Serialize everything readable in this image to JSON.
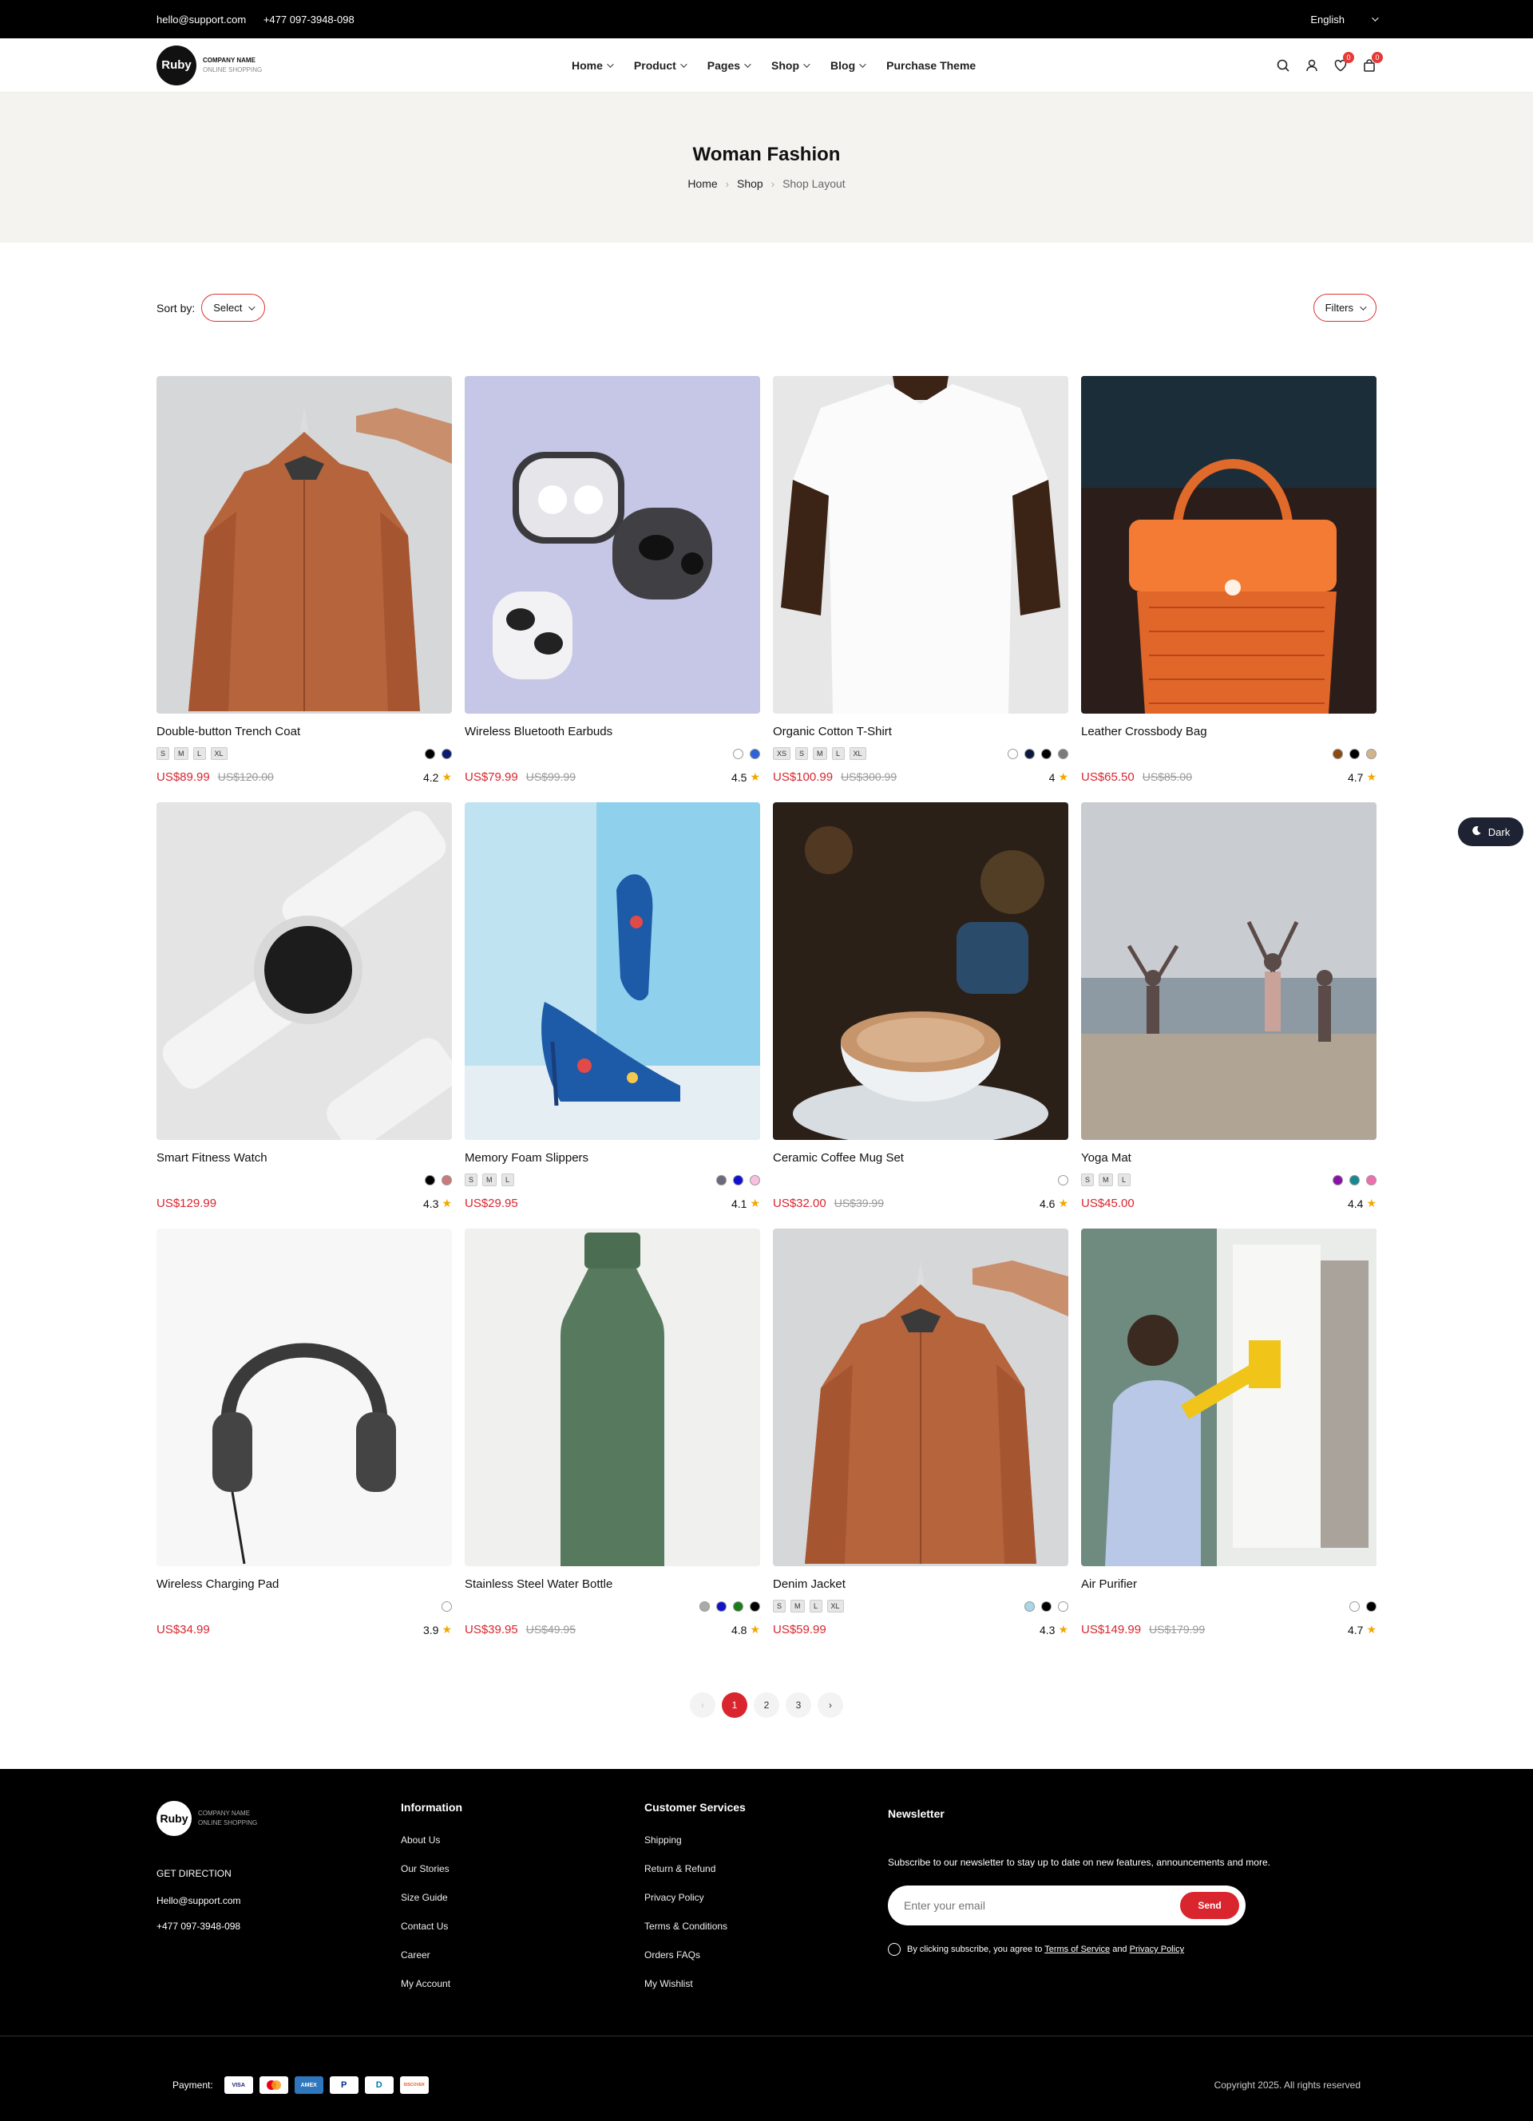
{
  "topbar": {
    "email": "hello@support.com",
    "phone": "+477 097-3948-098",
    "language": "English"
  },
  "header": {
    "logo_text": "Ruby",
    "company": "COMPANY NAME",
    "tagline": "ONLINE SHOPPING",
    "nav": [
      "Home",
      "Product",
      "Pages",
      "Shop",
      "Blog",
      "Purchase Theme"
    ],
    "wishlist_count": "0",
    "cart_count": "0"
  },
  "hero": {
    "title": "Woman Fashion",
    "crumbs": [
      "Home",
      "Shop",
      "Shop Layout"
    ]
  },
  "toolbar": {
    "sort_label": "Sort by:",
    "sort_value": "Select",
    "filters": "Filters"
  },
  "products": [
    {
      "name": "Double-button Trench Coat",
      "sizes": [
        "S",
        "M",
        "L",
        "XL"
      ],
      "colors": [
        "#000000",
        "#0a1a6e"
      ],
      "price": "US$89.99",
      "old": "US$120.00",
      "rating": "4.2",
      "image": "trench-jacket"
    },
    {
      "name": "Wireless Bluetooth Earbuds",
      "sizes": [],
      "colors": [
        "#ffffff",
        "#2e62d6"
      ],
      "price": "US$79.99",
      "old": "US$99.99",
      "rating": "4.5",
      "image": "earbuds"
    },
    {
      "name": "Organic Cotton T-Shirt",
      "sizes": [
        "XS",
        "S",
        "M",
        "L",
        "XL"
      ],
      "colors": [
        "#ffffff",
        "#0a1a3e",
        "#000000",
        "#7a7a7a"
      ],
      "price": "US$100.99",
      "old": "US$300.99",
      "rating": "4",
      "image": "tshirt"
    },
    {
      "name": "Leather Crossbody Bag",
      "sizes": [],
      "colors": [
        "#8b4a12",
        "#000000",
        "#d2b48c"
      ],
      "price": "US$65.50",
      "old": "US$85.00",
      "rating": "4.7",
      "image": "bag"
    },
    {
      "name": "Smart Fitness Watch",
      "sizes": [],
      "colors": [
        "#000000",
        "#c97b7b"
      ],
      "price": "US$129.99",
      "old": "",
      "rating": "4.3",
      "image": "watch"
    },
    {
      "name": "Memory Foam Slippers",
      "sizes": [
        "S",
        "M",
        "L"
      ],
      "colors": [
        "#6a6a7a",
        "#1010d0",
        "#f6c2e0"
      ],
      "price": "US$29.95",
      "old": "",
      "rating": "4.1",
      "image": "heels"
    },
    {
      "name": "Ceramic Coffee Mug Set",
      "sizes": [],
      "colors": [
        "#ffffff"
      ],
      "price": "US$32.00",
      "old": "US$39.99",
      "rating": "4.6",
      "image": "coffee"
    },
    {
      "name": "Yoga Mat",
      "sizes": [
        "S",
        "M",
        "L"
      ],
      "colors": [
        "#8a12a6",
        "#188890",
        "#ef6fae"
      ],
      "price": "US$45.00",
      "old": "",
      "rating": "4.4",
      "image": "yoga"
    },
    {
      "name": "Wireless Charging Pad",
      "sizes": [],
      "colors": [
        "#ffffff"
      ],
      "price": "US$34.99",
      "old": "",
      "rating": "3.9",
      "image": "headphones"
    },
    {
      "name": "Stainless Steel Water Bottle",
      "sizes": [],
      "colors": [
        "#aaaaaa",
        "#1212c8",
        "#1b7d1b",
        "#000000"
      ],
      "price": "US$39.95",
      "old": "US$49.95",
      "rating": "4.8",
      "image": "bottle"
    },
    {
      "name": "Denim Jacket",
      "sizes": [
        "S",
        "M",
        "L",
        "XL"
      ],
      "colors": [
        "#a7d6e8",
        "#000000",
        "#ffffff"
      ],
      "price": "US$59.99",
      "old": "",
      "rating": "4.3",
      "image": "trench-jacket"
    },
    {
      "name": "Air Purifier",
      "sizes": [],
      "colors": [
        "#ffffff",
        "#000000"
      ],
      "price": "US$149.99",
      "old": "US$179.99",
      "rating": "4.7",
      "image": "cleaning"
    }
  ],
  "pagination": {
    "prev": "‹",
    "pages": [
      "1",
      "2",
      "3"
    ],
    "current": "1",
    "next": "›"
  },
  "dark_toggle": "Dark",
  "footer": {
    "logo_text": "Ruby",
    "company": "COMPANY NAME",
    "tagline": "ONLINE SHOPPING",
    "direction": "GET DIRECTION",
    "email": "Hello@support.com",
    "phone": "+477 097-3948-098",
    "info_title": "Information",
    "info_links": [
      "About Us",
      "Our Stories",
      "Size Guide",
      "Contact Us",
      "Career",
      "My Account"
    ],
    "cs_title": "Customer Services",
    "cs_links": [
      "Shipping",
      "Return & Refund",
      "Privacy Policy",
      "Terms & Conditions",
      "Orders FAQs",
      "My Wishlist"
    ],
    "news_title": "Newsletter",
    "news_text": "Subscribe to our newsletter to stay up to date on new features, announcements and more.",
    "news_placeholder": "Enter your email",
    "send": "Send",
    "agree_prefix": "By clicking subscribe, you agree to ",
    "terms": "Terms of Service",
    "and": " and ",
    "privacy": "Privacy Policy",
    "payment_label": "Payment:",
    "payment_cards": [
      "VISA",
      "MC",
      "AMEX",
      "P",
      "D",
      "DISCOVER"
    ],
    "copyright": "Copyright 2025. All rights reserved"
  }
}
